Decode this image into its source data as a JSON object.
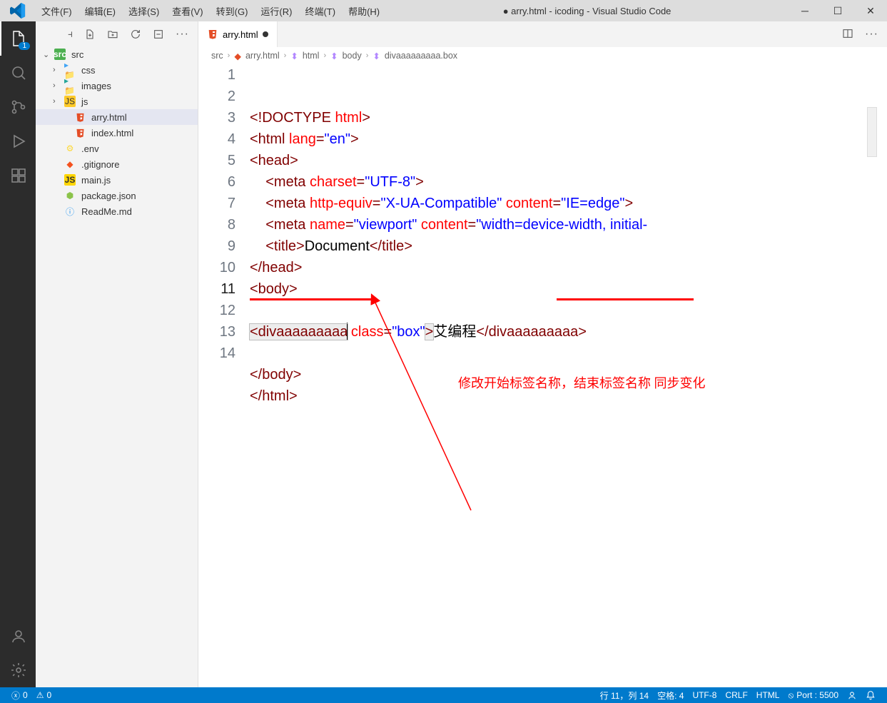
{
  "menubar": {
    "items": [
      "文件(F)",
      "编辑(E)",
      "选择(S)",
      "查看(V)",
      "转到(G)",
      "运行(R)",
      "终端(T)",
      "帮助(H)"
    ]
  },
  "window_title": "● arry.html - icoding - Visual Studio Code",
  "activity_badge": "1",
  "sidebar": {
    "tree": [
      {
        "chev": "⌄",
        "icon": "folder-src",
        "label": "src",
        "depth": 0
      },
      {
        "chev": "›",
        "icon": "folder-css",
        "label": "css",
        "depth": 1
      },
      {
        "chev": "›",
        "icon": "folder-img",
        "label": "images",
        "depth": 1
      },
      {
        "chev": "›",
        "icon": "folder-js",
        "label": "js",
        "depth": 1
      },
      {
        "chev": "",
        "icon": "html",
        "label": "arry.html",
        "depth": 2,
        "selected": true
      },
      {
        "chev": "",
        "icon": "html",
        "label": "index.html",
        "depth": 2
      },
      {
        "chev": "",
        "icon": "env",
        "label": ".env",
        "depth": 1
      },
      {
        "chev": "",
        "icon": "git",
        "label": ".gitignore",
        "depth": 1
      },
      {
        "chev": "",
        "icon": "js",
        "label": "main.js",
        "depth": 1
      },
      {
        "chev": "",
        "icon": "npm",
        "label": "package.json",
        "depth": 1
      },
      {
        "chev": "",
        "icon": "info",
        "label": "ReadMe.md",
        "depth": 1
      }
    ]
  },
  "tab": {
    "label": "arry.html"
  },
  "breadcrumb": {
    "parts": [
      "src",
      "arry.html",
      "html",
      "body",
      "divaaaaaaaaa.box"
    ]
  },
  "code": {
    "lines": [
      {
        "n": 1,
        "html": "<span class='t-br'>&lt;!DOCTYPE</span> <span class='t-attr'>html</span><span class='t-br'>&gt;</span>"
      },
      {
        "n": 2,
        "html": "<span class='t-br'>&lt;html</span> <span class='t-attr'>lang</span><span class='t-br'>=</span><span class='t-str'>\"en\"</span><span class='t-br'>&gt;</span>"
      },
      {
        "n": 3,
        "html": "<span class='t-br'>&lt;head&gt;</span>"
      },
      {
        "n": 4,
        "html": "    <span class='t-br'>&lt;meta</span> <span class='t-attr'>charset</span><span class='t-br'>=</span><span class='t-str'>\"UTF-8\"</span><span class='t-br'>&gt;</span>"
      },
      {
        "n": 5,
        "html": "    <span class='t-br'>&lt;meta</span> <span class='t-attr'>http-equiv</span><span class='t-br'>=</span><span class='t-str'>\"X-UA-Compatible\"</span> <span class='t-attr'>content</span><span class='t-br'>=</span><span class='t-str'>\"IE=edge\"</span><span class='t-br'>&gt;</span>"
      },
      {
        "n": 6,
        "html": "    <span class='t-br'>&lt;meta</span> <span class='t-attr'>name</span><span class='t-br'>=</span><span class='t-str'>\"viewport\"</span> <span class='t-attr'>content</span><span class='t-br'>=</span><span class='t-str'>\"width=device-width, initial-</span>"
      },
      {
        "n": 7,
        "html": "    <span class='t-br'>&lt;title&gt;</span><span class='t-txt'>Document</span><span class='t-br'>&lt;/title&gt;</span>"
      },
      {
        "n": 8,
        "html": "<span class='t-br'>&lt;/head&gt;</span>"
      },
      {
        "n": 9,
        "html": "<span class='t-br'>&lt;body&gt;</span>"
      },
      {
        "n": 10,
        "html": ""
      },
      {
        "n": 11,
        "html": "<span class='hl-box t-br'>&lt;divaaaaaaaaa</span><span class='cursor-line'></span> <span class='t-attr'>class</span><span class='t-br'>=</span><span class='t-str'>\"box\"</span><span class='hl-box t-br'>&gt;</span><span class='t-txt'>艾编程</span><span class='t-br'>&lt;/divaaaaaaaaa&gt;</span>",
        "cur": true
      },
      {
        "n": 12,
        "html": ""
      },
      {
        "n": 13,
        "html": "<span class='t-br'>&lt;/body&gt;</span>"
      },
      {
        "n": 14,
        "html": "<span class='t-br'>&lt;/html&gt;</span>"
      }
    ]
  },
  "annotation": "修改开始标签名称，结束标签名称 同步变化",
  "status": {
    "errors": "0",
    "warnings": "0",
    "ln_col": "行 11，列 14",
    "spaces": "空格: 4",
    "encoding": "UTF-8",
    "eol": "CRLF",
    "lang": "HTML",
    "port": "Port : 5500"
  }
}
